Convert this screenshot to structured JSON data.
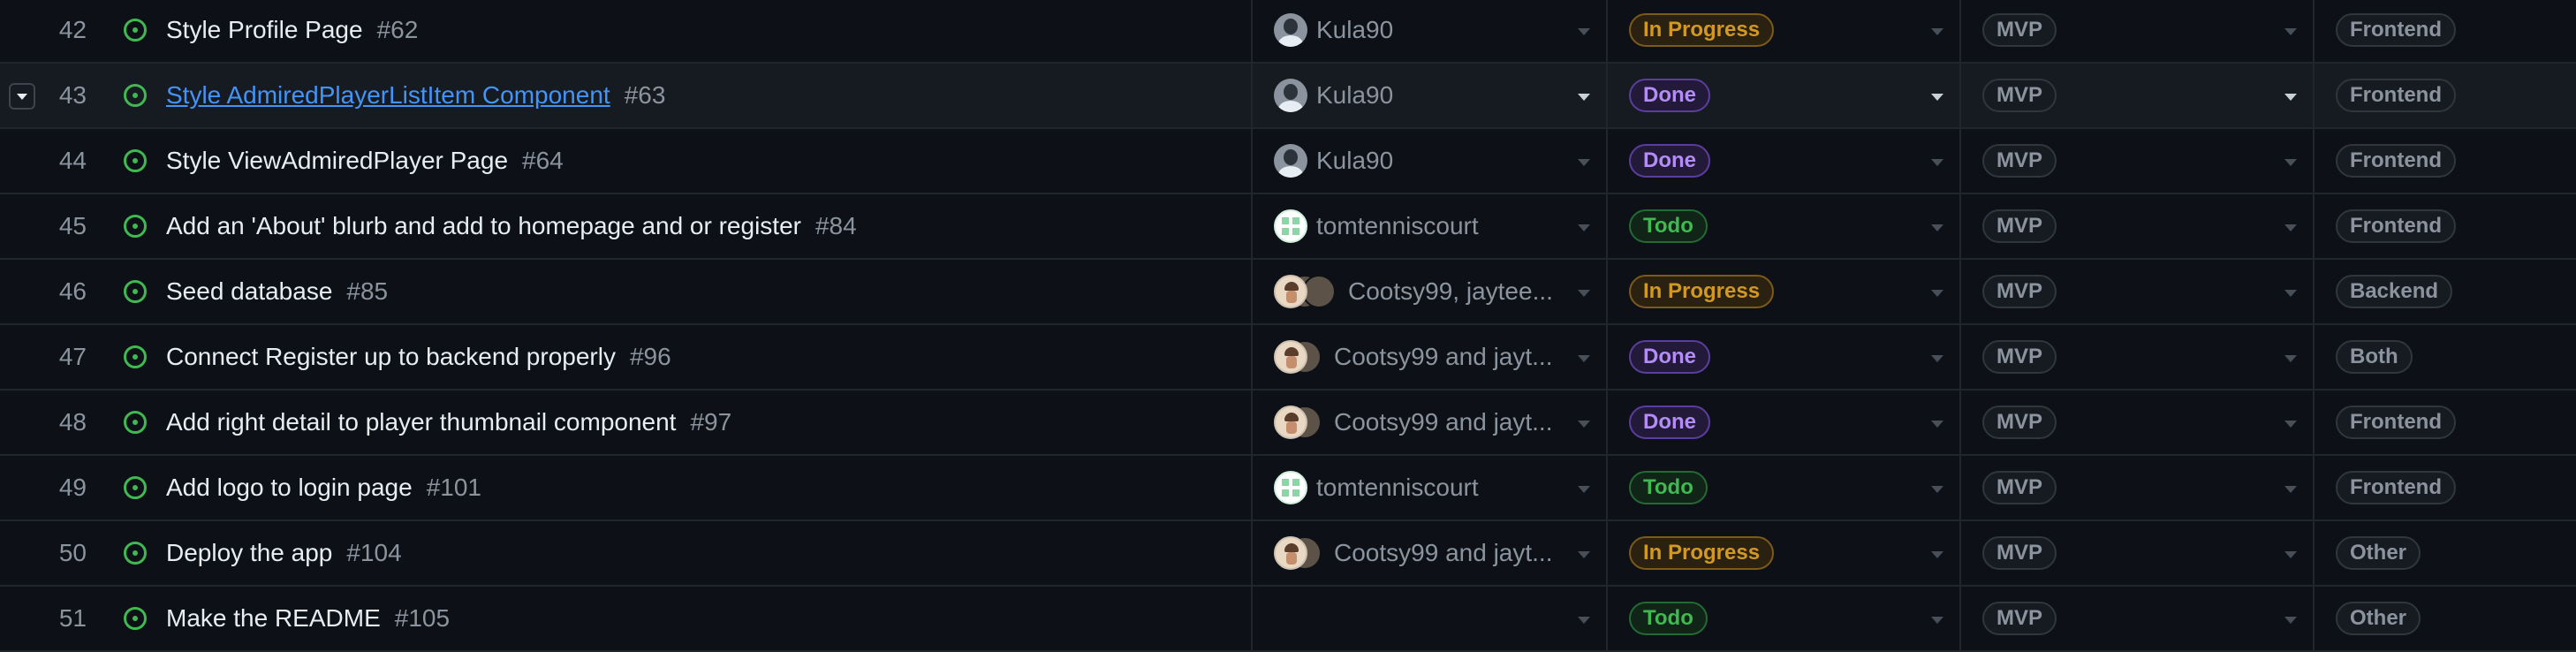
{
  "rows": [
    {
      "num": "42",
      "title": "Style Profile Page",
      "issue": "#62",
      "assignees": "Kula90",
      "avatar": "gray",
      "status": "In Progress",
      "status_class": "inprogress",
      "iteration": "MVP",
      "area": "Frontend"
    },
    {
      "num": "43",
      "title": "Style AdmiredPlayerListItem Component",
      "issue": "#63",
      "assignees": "Kula90",
      "avatar": "gray",
      "status": "Done",
      "status_class": "done",
      "iteration": "MVP",
      "area": "Frontend"
    },
    {
      "num": "44",
      "title": "Style ViewAdmiredPlayer Page",
      "issue": "#64",
      "assignees": "Kula90",
      "avatar": "gray",
      "status": "Done",
      "status_class": "done",
      "iteration": "MVP",
      "area": "Frontend"
    },
    {
      "num": "45",
      "title": "Add an 'About' blurb and add to homepage and or register",
      "issue": "#84",
      "assignees": "tomtenniscourt",
      "avatar": "identicon",
      "status": "Todo",
      "status_class": "todo",
      "iteration": "MVP",
      "area": "Frontend"
    },
    {
      "num": "46",
      "title": "Seed database",
      "issue": "#85",
      "assignees": "Cootsy99, jaytee...",
      "avatar": "multi3",
      "status": "In Progress",
      "status_class": "inprogress",
      "iteration": "MVP",
      "area": "Backend"
    },
    {
      "num": "47",
      "title": "Connect Register up to backend properly",
      "issue": "#96",
      "assignees": "Cootsy99 and jayt...",
      "avatar": "multi",
      "status": "Done",
      "status_class": "done",
      "iteration": "MVP",
      "area": "Both"
    },
    {
      "num": "48",
      "title": "Add right detail to player thumbnail component",
      "issue": "#97",
      "assignees": "Cootsy99 and jayt...",
      "avatar": "multi",
      "status": "Done",
      "status_class": "done",
      "iteration": "MVP",
      "area": "Frontend"
    },
    {
      "num": "49",
      "title": "Add logo to login page",
      "issue": "#101",
      "assignees": "tomtenniscourt",
      "avatar": "identicon",
      "status": "Todo",
      "status_class": "todo",
      "iteration": "MVP",
      "area": "Frontend"
    },
    {
      "num": "50",
      "title": "Deploy the app",
      "issue": "#104",
      "assignees": "Cootsy99 and jayt...",
      "avatar": "multi",
      "status": "In Progress",
      "status_class": "inprogress",
      "iteration": "MVP",
      "area": "Other"
    },
    {
      "num": "51",
      "title": "Make the README",
      "issue": "#105",
      "assignees": "",
      "avatar": "none",
      "status": "Todo",
      "status_class": "todo",
      "iteration": "MVP",
      "area": "Other"
    }
  ],
  "hovered_row": "43"
}
